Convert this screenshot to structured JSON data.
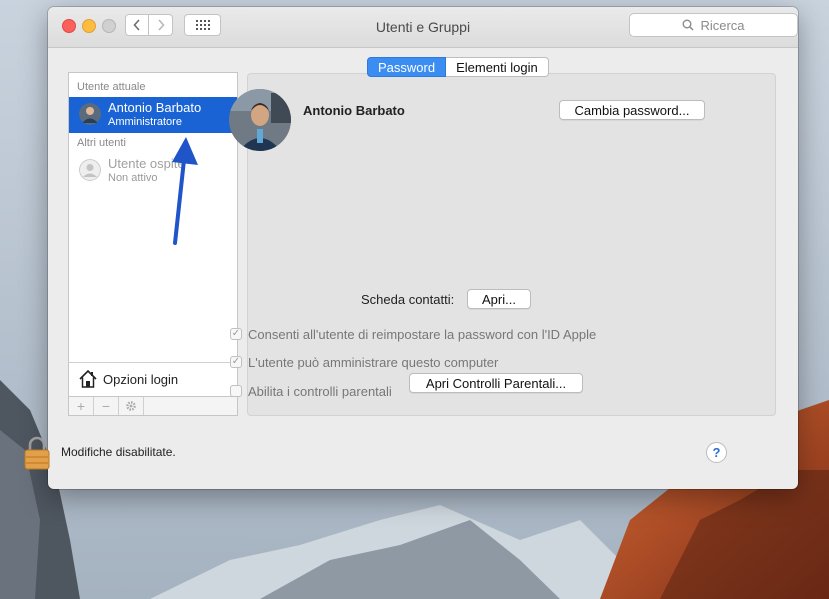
{
  "window": {
    "title": "Utenti e Gruppi",
    "search_placeholder": "Ricerca"
  },
  "sidebar": {
    "current_user_header": "Utente attuale",
    "current_user": {
      "name": "Antonio Barbato",
      "role": "Amministratore"
    },
    "other_users_header": "Altri utenti",
    "other_users": [
      {
        "name": "Utente ospite",
        "status": "Non attivo"
      }
    ],
    "login_options_label": "Opzioni login",
    "tools": {
      "add": "+",
      "remove": "−"
    }
  },
  "tabs": [
    {
      "label": "Password",
      "active": true
    },
    {
      "label": "Elementi login",
      "active": false
    }
  ],
  "user_panel": {
    "full_name": "Antonio Barbato",
    "change_password_button": "Cambia password...",
    "contact_card_label": "Scheda contatti:",
    "open_button": "Apri...",
    "options": [
      {
        "label": "Consenti all'utente di reimpostare la password con l'ID Apple",
        "checked": true
      },
      {
        "label": "L'utente può amministrare questo computer",
        "checked": true
      },
      {
        "label": "Abilita i controlli parentali",
        "checked": false
      }
    ],
    "parental_controls_button": "Apri Controlli Parentali..."
  },
  "footer": {
    "lock_text": "Modifiche disabilitate.",
    "help_symbol": "?"
  },
  "colors": {
    "selection": "#1a63d5",
    "tab_active": "#3b8df2",
    "annotation_arrow": "#1f55c8"
  }
}
